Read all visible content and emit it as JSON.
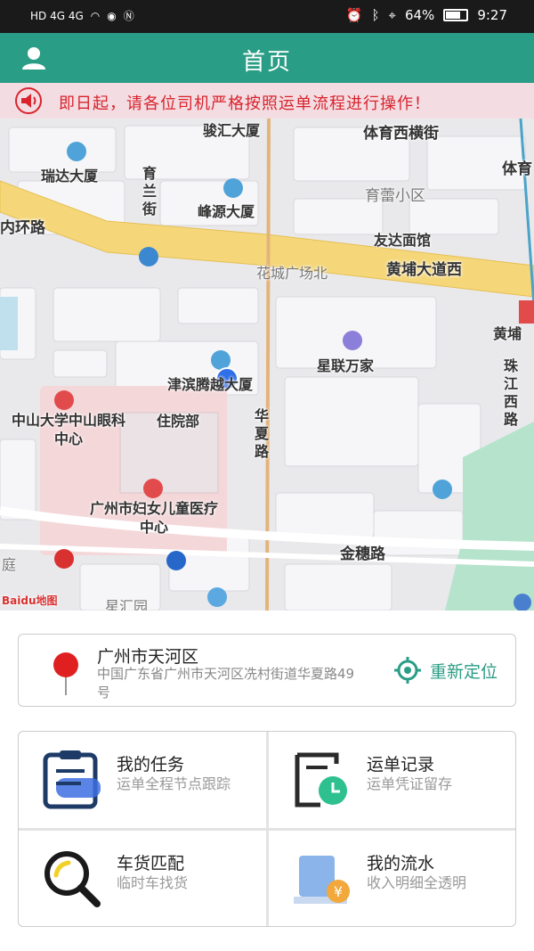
{
  "status_bar": {
    "network_left": "HD 4G 4G",
    "battery": "64%",
    "time": "9:27"
  },
  "header": {
    "title": "首页",
    "user_icon": "user-icon"
  },
  "notice": {
    "icon": "speaker-icon",
    "text": "即日起，请各位司机严格按照运单流程进行操作！"
  },
  "map": {
    "labels": {
      "junhui": "骏汇大厦",
      "tiyu_xiheng": "体育西横街",
      "tiyu": "体育",
      "ruida": "瑞达大厦",
      "yulan": "育兰街",
      "fengyuan": "峰源大厦",
      "yulei": "育蕾小区",
      "neihuan": "内环路",
      "youda": "友达面馆",
      "huacheng": "花城广场北",
      "huangpu_dadao": "黄埔大道西",
      "huangpu_r": "黄埔",
      "xinglian": "星联万家",
      "zhujiang": "珠江西路",
      "jinbin": "津滨腾越大厦",
      "zhongshan": "中山大学中山眼科中心",
      "zhuyuan": "住院部",
      "huaxia": "华夏路",
      "fuyou": "广州市妇女儿童医疗中心",
      "jinsui": "金穗路",
      "ting": "庭",
      "xinghui": "星汇园",
      "logo": "Baidu地图"
    }
  },
  "location": {
    "city": "广州市天河区",
    "address": "中国广东省广州市天河区冼村街道华夏路49号",
    "relocate_label": "重新定位"
  },
  "menu": [
    {
      "title": "我的任务",
      "subtitle": "运单全程节点跟踪",
      "icon": "clipboard-icon"
    },
    {
      "title": "运单记录",
      "subtitle": "运单凭证留存",
      "icon": "record-clock-icon"
    },
    {
      "title": "车货匹配",
      "subtitle": "临时车找货",
      "icon": "magnifier-icon"
    },
    {
      "title": "我的流水",
      "subtitle": "收入明细全透明",
      "icon": "wallet-yuan-icon"
    }
  ],
  "colors": {
    "primary": "#2a9d86",
    "notice_bg": "#f3dde2",
    "notice_text": "#d9232d",
    "road_yellow": "#f5d77a"
  }
}
